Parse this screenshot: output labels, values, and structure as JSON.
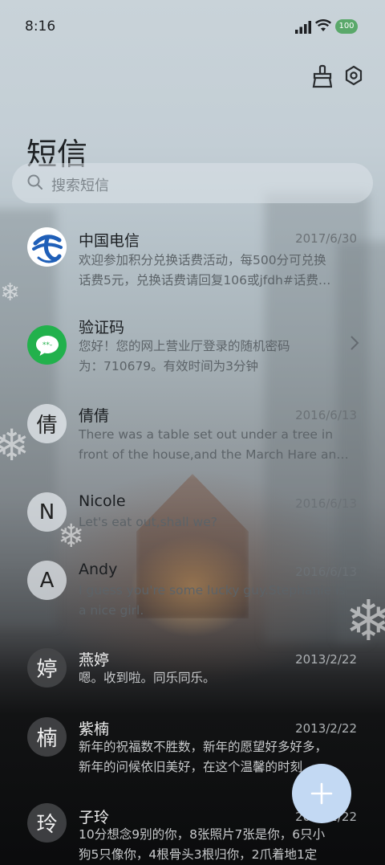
{
  "status_bar": {
    "time": "8:16",
    "battery": "100"
  },
  "header": {
    "title": "短信"
  },
  "search": {
    "placeholder": "搜索短信"
  },
  "conversations": [
    {
      "name": "中国电信",
      "date": "2017/6/30",
      "avatar": "telecom-logo",
      "lines": [
        "欢迎参加积分兑换话费活动，每500分可兑换",
        "话费5元，兑换话费请回复106或jfdh#话费…"
      ]
    },
    {
      "name": "验证码",
      "date": "",
      "avatar": "message-bubble",
      "lines": [
        "您好！您的网上营业厅登录的随机密码",
        "为：710679。有效时间为3分钟"
      ]
    },
    {
      "name": "倩倩",
      "date": "2016/6/13",
      "avatar": "倩",
      "lines": [
        "There was a table set out under a tree in",
        "front of the house,and the March Hare an…"
      ]
    },
    {
      "name": "Nicole",
      "date": "2016/6/13",
      "avatar": "N",
      "lines": [
        "Let's eat out,shall we?"
      ]
    },
    {
      "name": "Andy",
      "date": "2016/6/13",
      "avatar": "A",
      "lines": [
        "I guess you're some lucky guy.Stephanie is",
        "a nice girl."
      ]
    },
    {
      "name": "燕婷",
      "date": "2013/2/22",
      "avatar": "婷",
      "lines": [
        "嗯。收到啦。同乐同乐。"
      ]
    },
    {
      "name": "紫楠",
      "date": "2013/2/22",
      "avatar": "楠",
      "lines": [
        "新年的祝福数不胜数，新年的愿望好多好多，",
        "新年的问候依旧美好，在这个温馨的时刻…"
      ]
    },
    {
      "name": "子玲",
      "date": "2013/2/22",
      "avatar": "玲",
      "lines": [
        "10分想念9别的你，8张照片7张是你，6只小",
        "狗5只像你，4根骨头3根归你，2爪着地1定"
      ]
    }
  ],
  "fab": {
    "icon": "plus-icon",
    "color": "#c3d9f3"
  },
  "colors": {
    "telecom_blue": "#1f5fb8",
    "chat_green": "#22b14c"
  }
}
